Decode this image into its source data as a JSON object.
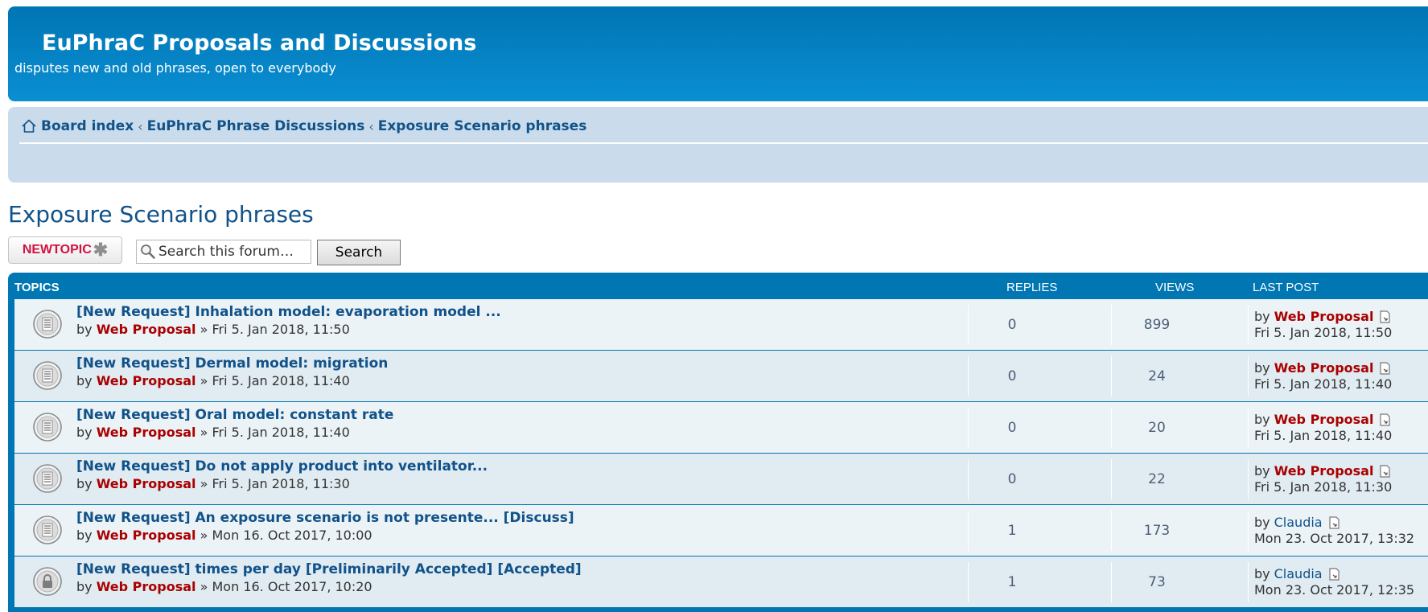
{
  "header": {
    "site_title": "EuPhraC Proposals and Discussions",
    "site_description": "disputes new and old phrases, open to everybody"
  },
  "breadcrumb": {
    "items": [
      "Board index",
      "EuPhraC Phrase Discussions",
      "Exposure Scenario phrases"
    ],
    "separator": "‹"
  },
  "forum": {
    "title": "Exposure Scenario phrases"
  },
  "actions": {
    "new_topic_label": "NEWTOPIC",
    "search_placeholder": "Search this forum…",
    "search_button": "Search"
  },
  "table": {
    "headers": {
      "topics": "TOPICS",
      "replies": "REPLIES",
      "views": "VIEWS",
      "last_post": "LAST POST"
    },
    "rows": [
      {
        "title": "[New Request] Inhalation model: evaporation model ...",
        "by": "by",
        "author": "Web Proposal",
        "posted": "» Fri 5. Jan 2018, 11:50",
        "replies": "0",
        "views": "899",
        "last_by": "by",
        "last_author": "Web Proposal",
        "last_time": "Fri 5. Jan 2018, 11:50",
        "locked": false,
        "author_highlight": true
      },
      {
        "title": "[New Request] Dermal model: migration",
        "by": "by",
        "author": "Web Proposal",
        "posted": "» Fri 5. Jan 2018, 11:40",
        "replies": "0",
        "views": "24",
        "last_by": "by",
        "last_author": "Web Proposal",
        "last_time": "Fri 5. Jan 2018, 11:40",
        "locked": false,
        "author_highlight": true
      },
      {
        "title": "[New Request] Oral model: constant rate",
        "by": "by",
        "author": "Web Proposal",
        "posted": "» Fri 5. Jan 2018, 11:40",
        "replies": "0",
        "views": "20",
        "last_by": "by",
        "last_author": "Web Proposal",
        "last_time": "Fri 5. Jan 2018, 11:40",
        "locked": false,
        "author_highlight": true
      },
      {
        "title": "[New Request] Do not apply product into ventilator...",
        "by": "by",
        "author": "Web Proposal",
        "posted": "» Fri 5. Jan 2018, 11:30",
        "replies": "0",
        "views": "22",
        "last_by": "by",
        "last_author": "Web Proposal",
        "last_time": "Fri 5. Jan 2018, 11:30",
        "locked": false,
        "author_highlight": true
      },
      {
        "title": "[New Request] An exposure scenario is not presente... [Discuss]",
        "by": "by",
        "author": "Web Proposal",
        "posted": "» Mon 16. Oct 2017, 10:00",
        "replies": "1",
        "views": "173",
        "last_by": "by",
        "last_author": "Claudia",
        "last_time": "Mon 23. Oct 2017, 13:32",
        "locked": false,
        "author_highlight": false
      },
      {
        "title": "[New Request] times per day [Preliminarily Accepted] [Accepted]",
        "by": "by",
        "author": "Web Proposal",
        "posted": "» Mon 16. Oct 2017, 10:20",
        "replies": "1",
        "views": "73",
        "last_by": "by",
        "last_author": "Claudia",
        "last_time": "Mon 23. Oct 2017, 12:35",
        "locked": true,
        "author_highlight": false
      }
    ]
  },
  "colors": {
    "header_blue": "#0075b3",
    "link_blue": "#105289",
    "author_red": "#aa0000",
    "row_light": "#ecf3f7",
    "row_alt": "#e1ebf2"
  }
}
